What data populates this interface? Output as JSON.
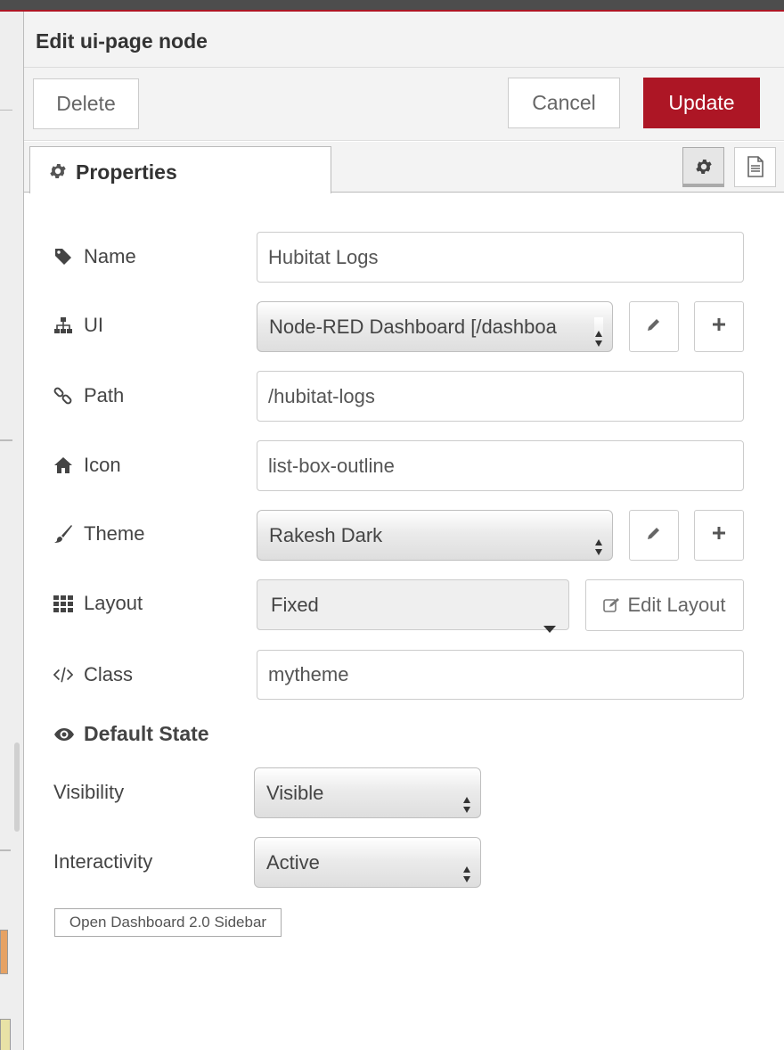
{
  "tray": {
    "title": "Edit ui-page node",
    "delete_label": "Delete",
    "cancel_label": "Cancel",
    "update_label": "Update",
    "accent_color": "#ad1625"
  },
  "tabs": {
    "properties_label": "Properties",
    "icons": [
      "gear-icon",
      "description-icon"
    ]
  },
  "fields": {
    "name": {
      "label": "Name",
      "value": "Hubitat Logs",
      "icon": "tag-icon"
    },
    "ui": {
      "label": "UI",
      "value": "Node-RED Dashboard [/dashboa",
      "icon": "sitemap-icon"
    },
    "path": {
      "label": "Path",
      "value": "/hubitat-logs",
      "icon": "link-icon"
    },
    "icon": {
      "label": "Icon",
      "value": "list-box-outline",
      "icon": "home-icon"
    },
    "theme": {
      "label": "Theme",
      "value": "Rakesh Dark",
      "icon": "paintbrush-icon"
    },
    "layout": {
      "label": "Layout",
      "value": "Fixed",
      "icon": "grid-icon",
      "edit_label": "Edit Layout"
    },
    "class": {
      "label": "Class",
      "value": "mytheme",
      "icon": "code-icon"
    }
  },
  "default_state": {
    "title": "Default State",
    "visibility_label": "Visibility",
    "visibility_value": "Visible",
    "interactivity_label": "Interactivity",
    "interactivity_value": "Active"
  },
  "sidebar_button_label": "Open Dashboard 2.0 Sidebar"
}
